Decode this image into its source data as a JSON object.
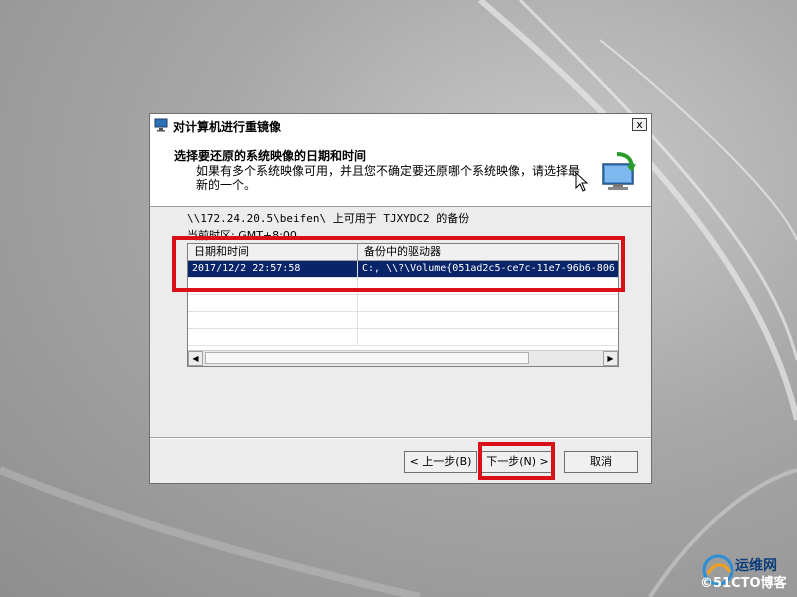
{
  "dialog": {
    "title": "对计算机进行重镜像",
    "close_label": "x",
    "header": {
      "title": "选择要还原的系统映像的日期和时间",
      "description": "如果有多个系统映像可用，并且您不确定要还原哪个系统映像，请选择最新的一个。"
    },
    "source_text": "\\\\172.24.20.5\\beifen\\ 上可用于 TJXYDC2 的备份",
    "timezone_text": "当前时区: GMT+8:00",
    "list": {
      "columns": [
        "日期和时间",
        "备份中的驱动器"
      ],
      "rows": [
        {
          "date": "2017/12/2 22:57:58",
          "drives": "C:, \\\\?\\Volume{051ad2c5-ce7c-11e7-96b6-806"
        }
      ]
    },
    "buttons": {
      "back": "< 上一步(B)",
      "next": "下一步(N) >",
      "cancel": "取消"
    }
  },
  "watermark": {
    "line1": "运维网",
    "line2": "©51CTO博客"
  },
  "colors": {
    "highlight": "#d9101a",
    "selection": "#0a246a"
  }
}
